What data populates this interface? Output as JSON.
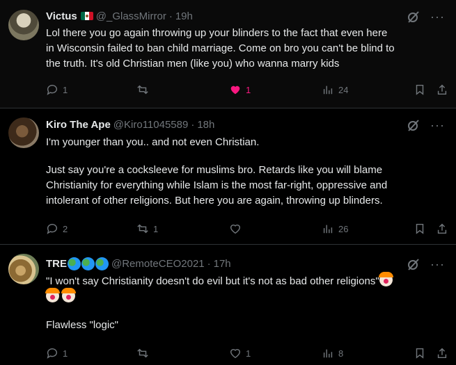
{
  "posts": [
    {
      "author": "Victus",
      "handle": "@_GlassMirror",
      "time": "19h",
      "flag": "mexico-flag",
      "text": [
        "Lol there you go again throwing up your blinders to the fact that even here",
        "in Wisconsin failed to ban child marriage. Come on bro you can't be blind to",
        "the truth. It's old Christian men (like you) who wanna marry kids"
      ],
      "replies": "1",
      "reposts": "",
      "likes": "1",
      "liked": true,
      "views": "24"
    },
    {
      "author": "Kiro The Ape",
      "handle": "@Kiro11045589",
      "time": "18h",
      "text_a": "I'm younger than you.. and not even Christian.",
      "text_b": [
        "Just say you're a cocksleeve for muslims bro. Retards like you will blame",
        "Christianity for everything while Islam is the most far-right, oppressive and",
        "intolerant of other religions. But here you are again, throwing up blinders."
      ],
      "replies": "2",
      "reposts": "1",
      "likes": "",
      "views": "26"
    },
    {
      "author": "TRE",
      "handle": "@RemoteCEO2021",
      "time": "17h",
      "text_a": "\"I won't say Christianity doesn't do evil but it's not as bad other religions\"",
      "text_b": "Flawless \"logic\"",
      "replies": "1",
      "reposts": "",
      "likes": "1",
      "views": "8"
    }
  ],
  "separator": "·"
}
